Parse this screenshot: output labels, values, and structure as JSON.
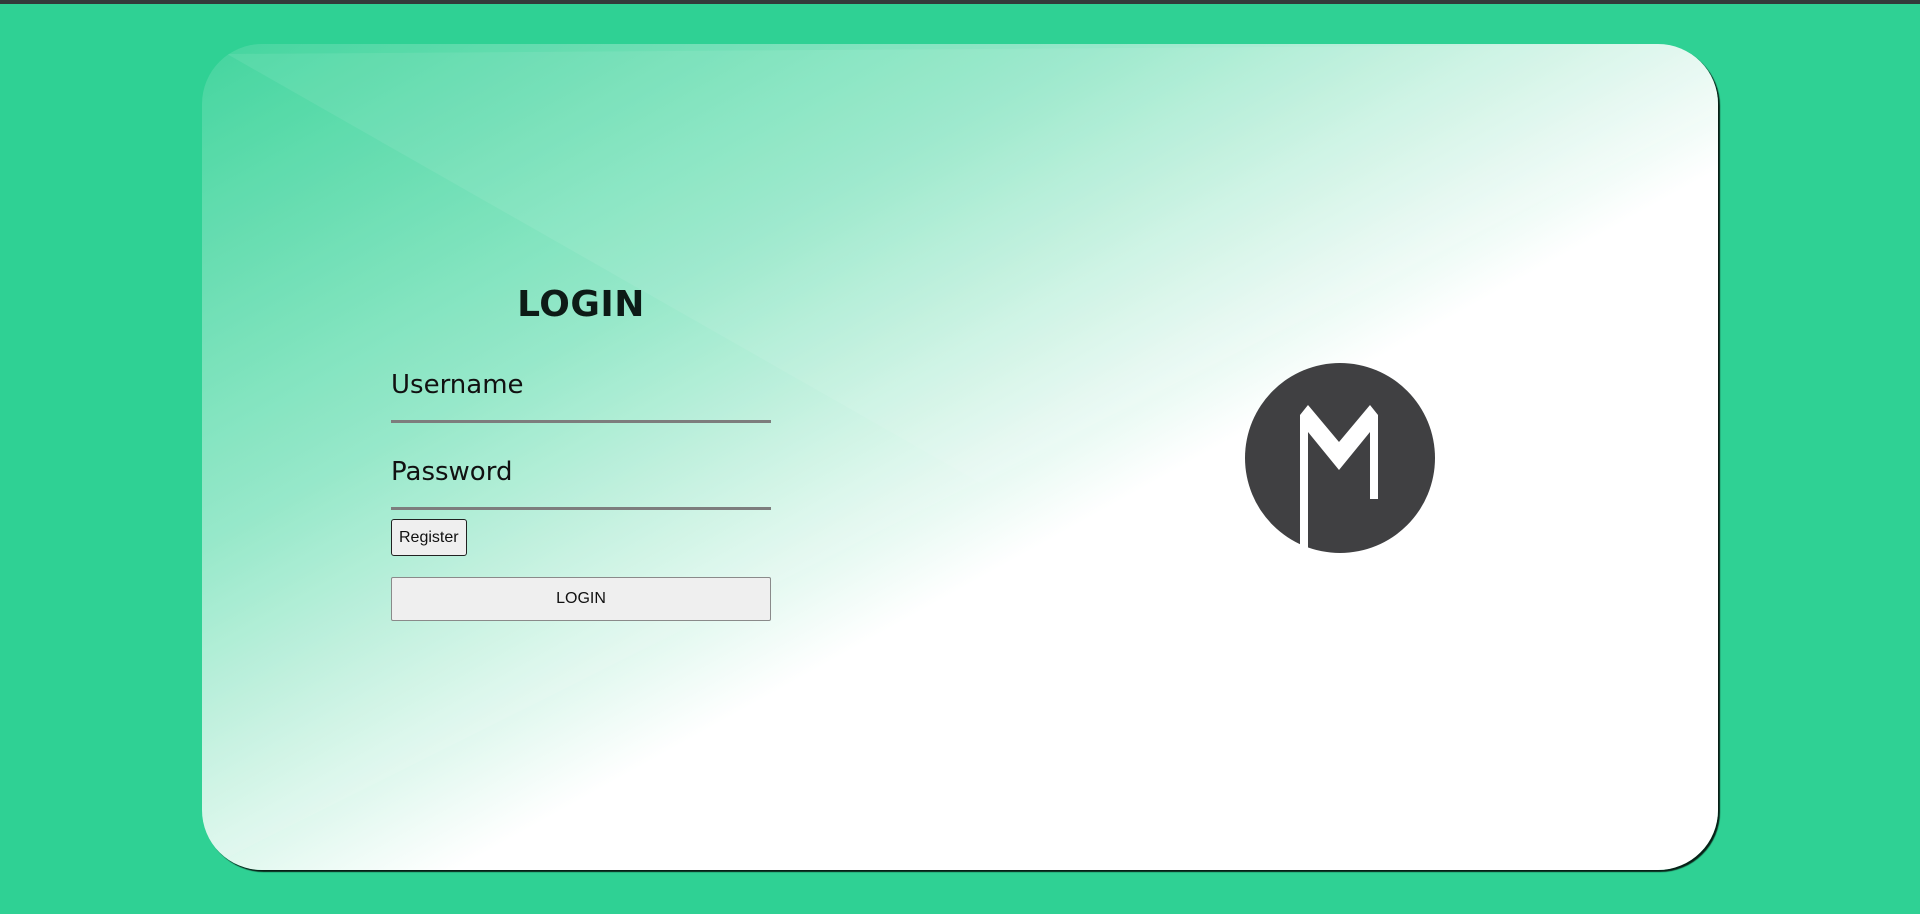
{
  "login": {
    "title": "LOGIN",
    "username_placeholder": "Username",
    "username_value": "",
    "password_placeholder": "Password",
    "password_value": "",
    "register_label": "Register",
    "submit_label": "LOGIN"
  },
  "logo": {
    "icon": "m-logo-icon",
    "circle_color": "#404042",
    "glyph_color": "#ffffff"
  },
  "colors": {
    "background": "#2fd194",
    "card_gradient_start": "#2fd194",
    "card_gradient_end": "#ffffff",
    "top_strip": "#333b3a"
  }
}
